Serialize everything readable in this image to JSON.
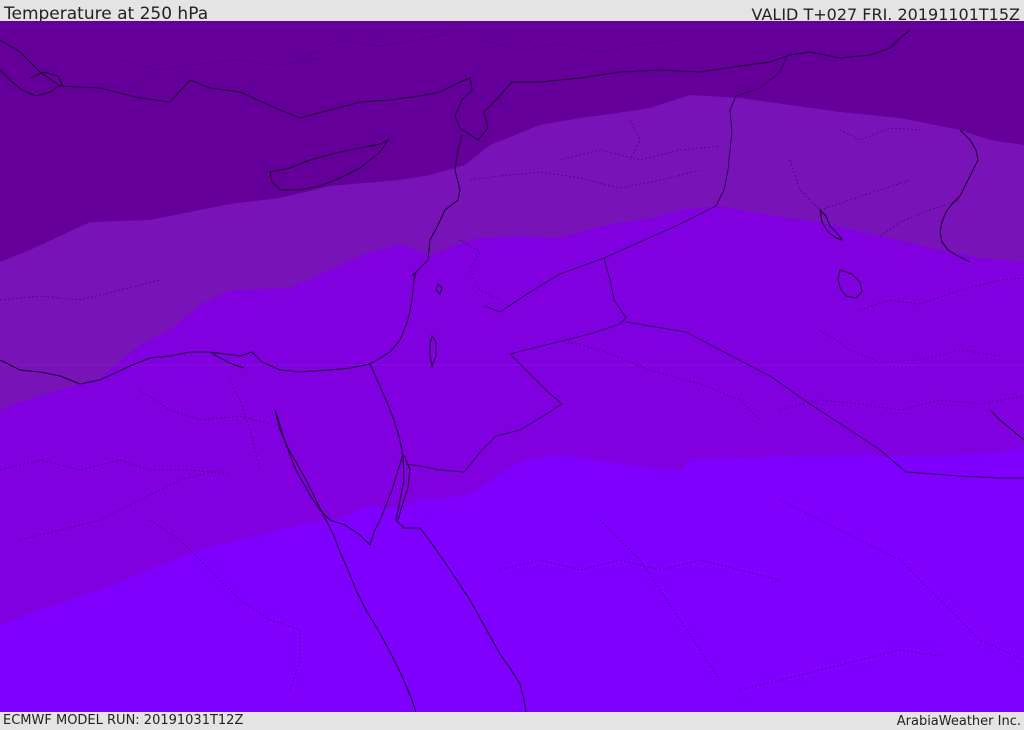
{
  "header": {
    "title": "Temperature at 250 hPa",
    "valid_time": "VALID T+027 FRI. 20191101T15Z"
  },
  "footer": {
    "model_run": "ECMWF MODEL RUN: 20191031T12Z",
    "credit": "ArabiaWeather Inc."
  },
  "map": {
    "region": "Eastern Mediterranean / Middle East",
    "colors": {
      "band_coldest": "#640099",
      "band_cold": "#7813b8",
      "band_mid": "#8000e0",
      "band_warm": "#7f00ff",
      "coastline": "#1a0030",
      "border": "#2a0050"
    }
  }
}
